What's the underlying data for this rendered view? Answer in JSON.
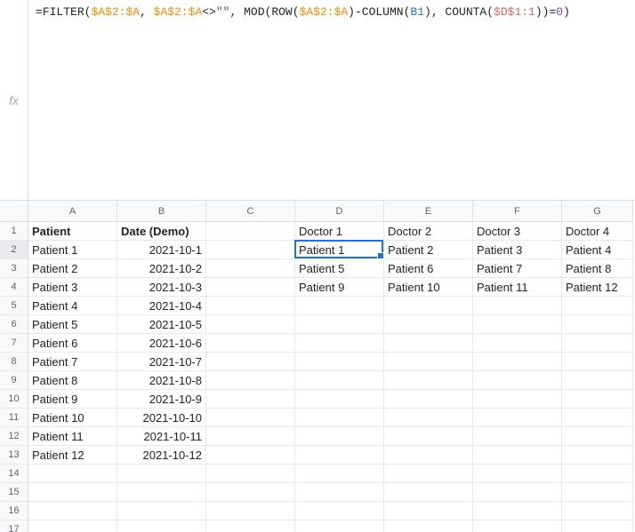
{
  "fx_label": "fx",
  "formula_tokens": [
    {
      "t": "=",
      "c": "f-black"
    },
    {
      "t": "FILTER",
      "c": "f-black"
    },
    {
      "t": "(",
      "c": "f-black"
    },
    {
      "t": "$A$2:$A",
      "c": "f-orange"
    },
    {
      "t": ", ",
      "c": "f-black"
    },
    {
      "t": "$A$2:$A",
      "c": "f-orange"
    },
    {
      "t": "<>",
      "c": "f-black"
    },
    {
      "t": "\"\"",
      "c": "f-green"
    },
    {
      "t": ", ",
      "c": "f-black"
    },
    {
      "t": "MOD",
      "c": "f-black"
    },
    {
      "t": "(",
      "c": "f-black"
    },
    {
      "t": "ROW",
      "c": "f-black"
    },
    {
      "t": "(",
      "c": "f-black"
    },
    {
      "t": "$A$2:$A",
      "c": "f-orange"
    },
    {
      "t": ")",
      "c": "f-black"
    },
    {
      "t": "-",
      "c": "f-black"
    },
    {
      "t": "COLUMN",
      "c": "f-black"
    },
    {
      "t": "(",
      "c": "f-black"
    },
    {
      "t": "B1",
      "c": "f-blue"
    },
    {
      "t": ")",
      "c": "f-black"
    },
    {
      "t": ", ",
      "c": "f-black"
    },
    {
      "t": "COUNTA",
      "c": "f-black"
    },
    {
      "t": "(",
      "c": "f-black"
    },
    {
      "t": "$D$1:1",
      "c": "f-red"
    },
    {
      "t": "))",
      "c": "f-black"
    },
    {
      "t": "=",
      "c": "f-black"
    },
    {
      "t": "0",
      "c": "f-purple"
    },
    {
      "t": ")",
      "c": "f-black"
    }
  ],
  "columns": [
    "A",
    "B",
    "C",
    "D",
    "E",
    "F",
    "G"
  ],
  "row_count": 17,
  "active": {
    "row": 2,
    "col": "D"
  },
  "cells": {
    "A1": {
      "v": "Patient",
      "bold": true
    },
    "B1": {
      "v": "Date (Demo)",
      "bold": true
    },
    "D1": {
      "v": "Doctor 1"
    },
    "E1": {
      "v": "Doctor 2"
    },
    "F1": {
      "v": "Doctor 3"
    },
    "G1": {
      "v": "Doctor 4"
    },
    "A2": {
      "v": "Patient 1"
    },
    "B2": {
      "v": "2021-10-1",
      "right": true
    },
    "D2": {
      "v": "Patient 1"
    },
    "E2": {
      "v": "Patient 2"
    },
    "F2": {
      "v": "Patient 3"
    },
    "G2": {
      "v": "Patient 4"
    },
    "A3": {
      "v": "Patient 2"
    },
    "B3": {
      "v": "2021-10-2",
      "right": true
    },
    "D3": {
      "v": "Patient 5"
    },
    "E3": {
      "v": "Patient 6"
    },
    "F3": {
      "v": "Patient 7"
    },
    "G3": {
      "v": "Patient 8"
    },
    "A4": {
      "v": "Patient 3"
    },
    "B4": {
      "v": "2021-10-3",
      "right": true
    },
    "D4": {
      "v": "Patient 9"
    },
    "E4": {
      "v": "Patient 10"
    },
    "F4": {
      "v": "Patient 11"
    },
    "G4": {
      "v": "Patient 12"
    },
    "A5": {
      "v": "Patient 4"
    },
    "B5": {
      "v": "2021-10-4",
      "right": true
    },
    "A6": {
      "v": "Patient 5"
    },
    "B6": {
      "v": "2021-10-5",
      "right": true
    },
    "A7": {
      "v": "Patient 6"
    },
    "B7": {
      "v": "2021-10-6",
      "right": true
    },
    "A8": {
      "v": "Patient 7"
    },
    "B8": {
      "v": "2021-10-7",
      "right": true
    },
    "A9": {
      "v": "Patient 8"
    },
    "B9": {
      "v": "2021-10-8",
      "right": true
    },
    "A10": {
      "v": "Patient 9"
    },
    "B10": {
      "v": "2021-10-9",
      "right": true
    },
    "A11": {
      "v": "Patient 10"
    },
    "B11": {
      "v": "2021-10-10",
      "right": true
    },
    "A12": {
      "v": "Patient 11"
    },
    "B12": {
      "v": "2021-10-11",
      "right": true
    },
    "A13": {
      "v": "Patient 12"
    },
    "B13": {
      "v": "2021-10-12",
      "right": true
    }
  },
  "chart_data": {
    "type": "table",
    "columns_left": [
      "Patient",
      "Date (Demo)"
    ],
    "rows_left": [
      [
        "Patient 1",
        "2021-10-1"
      ],
      [
        "Patient 2",
        "2021-10-2"
      ],
      [
        "Patient 3",
        "2021-10-3"
      ],
      [
        "Patient 4",
        "2021-10-4"
      ],
      [
        "Patient 5",
        "2021-10-5"
      ],
      [
        "Patient 6",
        "2021-10-6"
      ],
      [
        "Patient 7",
        "2021-10-7"
      ],
      [
        "Patient 8",
        "2021-10-8"
      ],
      [
        "Patient 9",
        "2021-10-9"
      ],
      [
        "Patient 10",
        "2021-10-10"
      ],
      [
        "Patient 11",
        "2021-10-11"
      ],
      [
        "Patient 12",
        "2021-10-12"
      ]
    ],
    "columns_right": [
      "Doctor 1",
      "Doctor 2",
      "Doctor 3",
      "Doctor 4"
    ],
    "rows_right": [
      [
        "Patient 1",
        "Patient 2",
        "Patient 3",
        "Patient 4"
      ],
      [
        "Patient 5",
        "Patient 6",
        "Patient 7",
        "Patient 8"
      ],
      [
        "Patient 9",
        "Patient 10",
        "Patient 11",
        "Patient 12"
      ]
    ]
  }
}
